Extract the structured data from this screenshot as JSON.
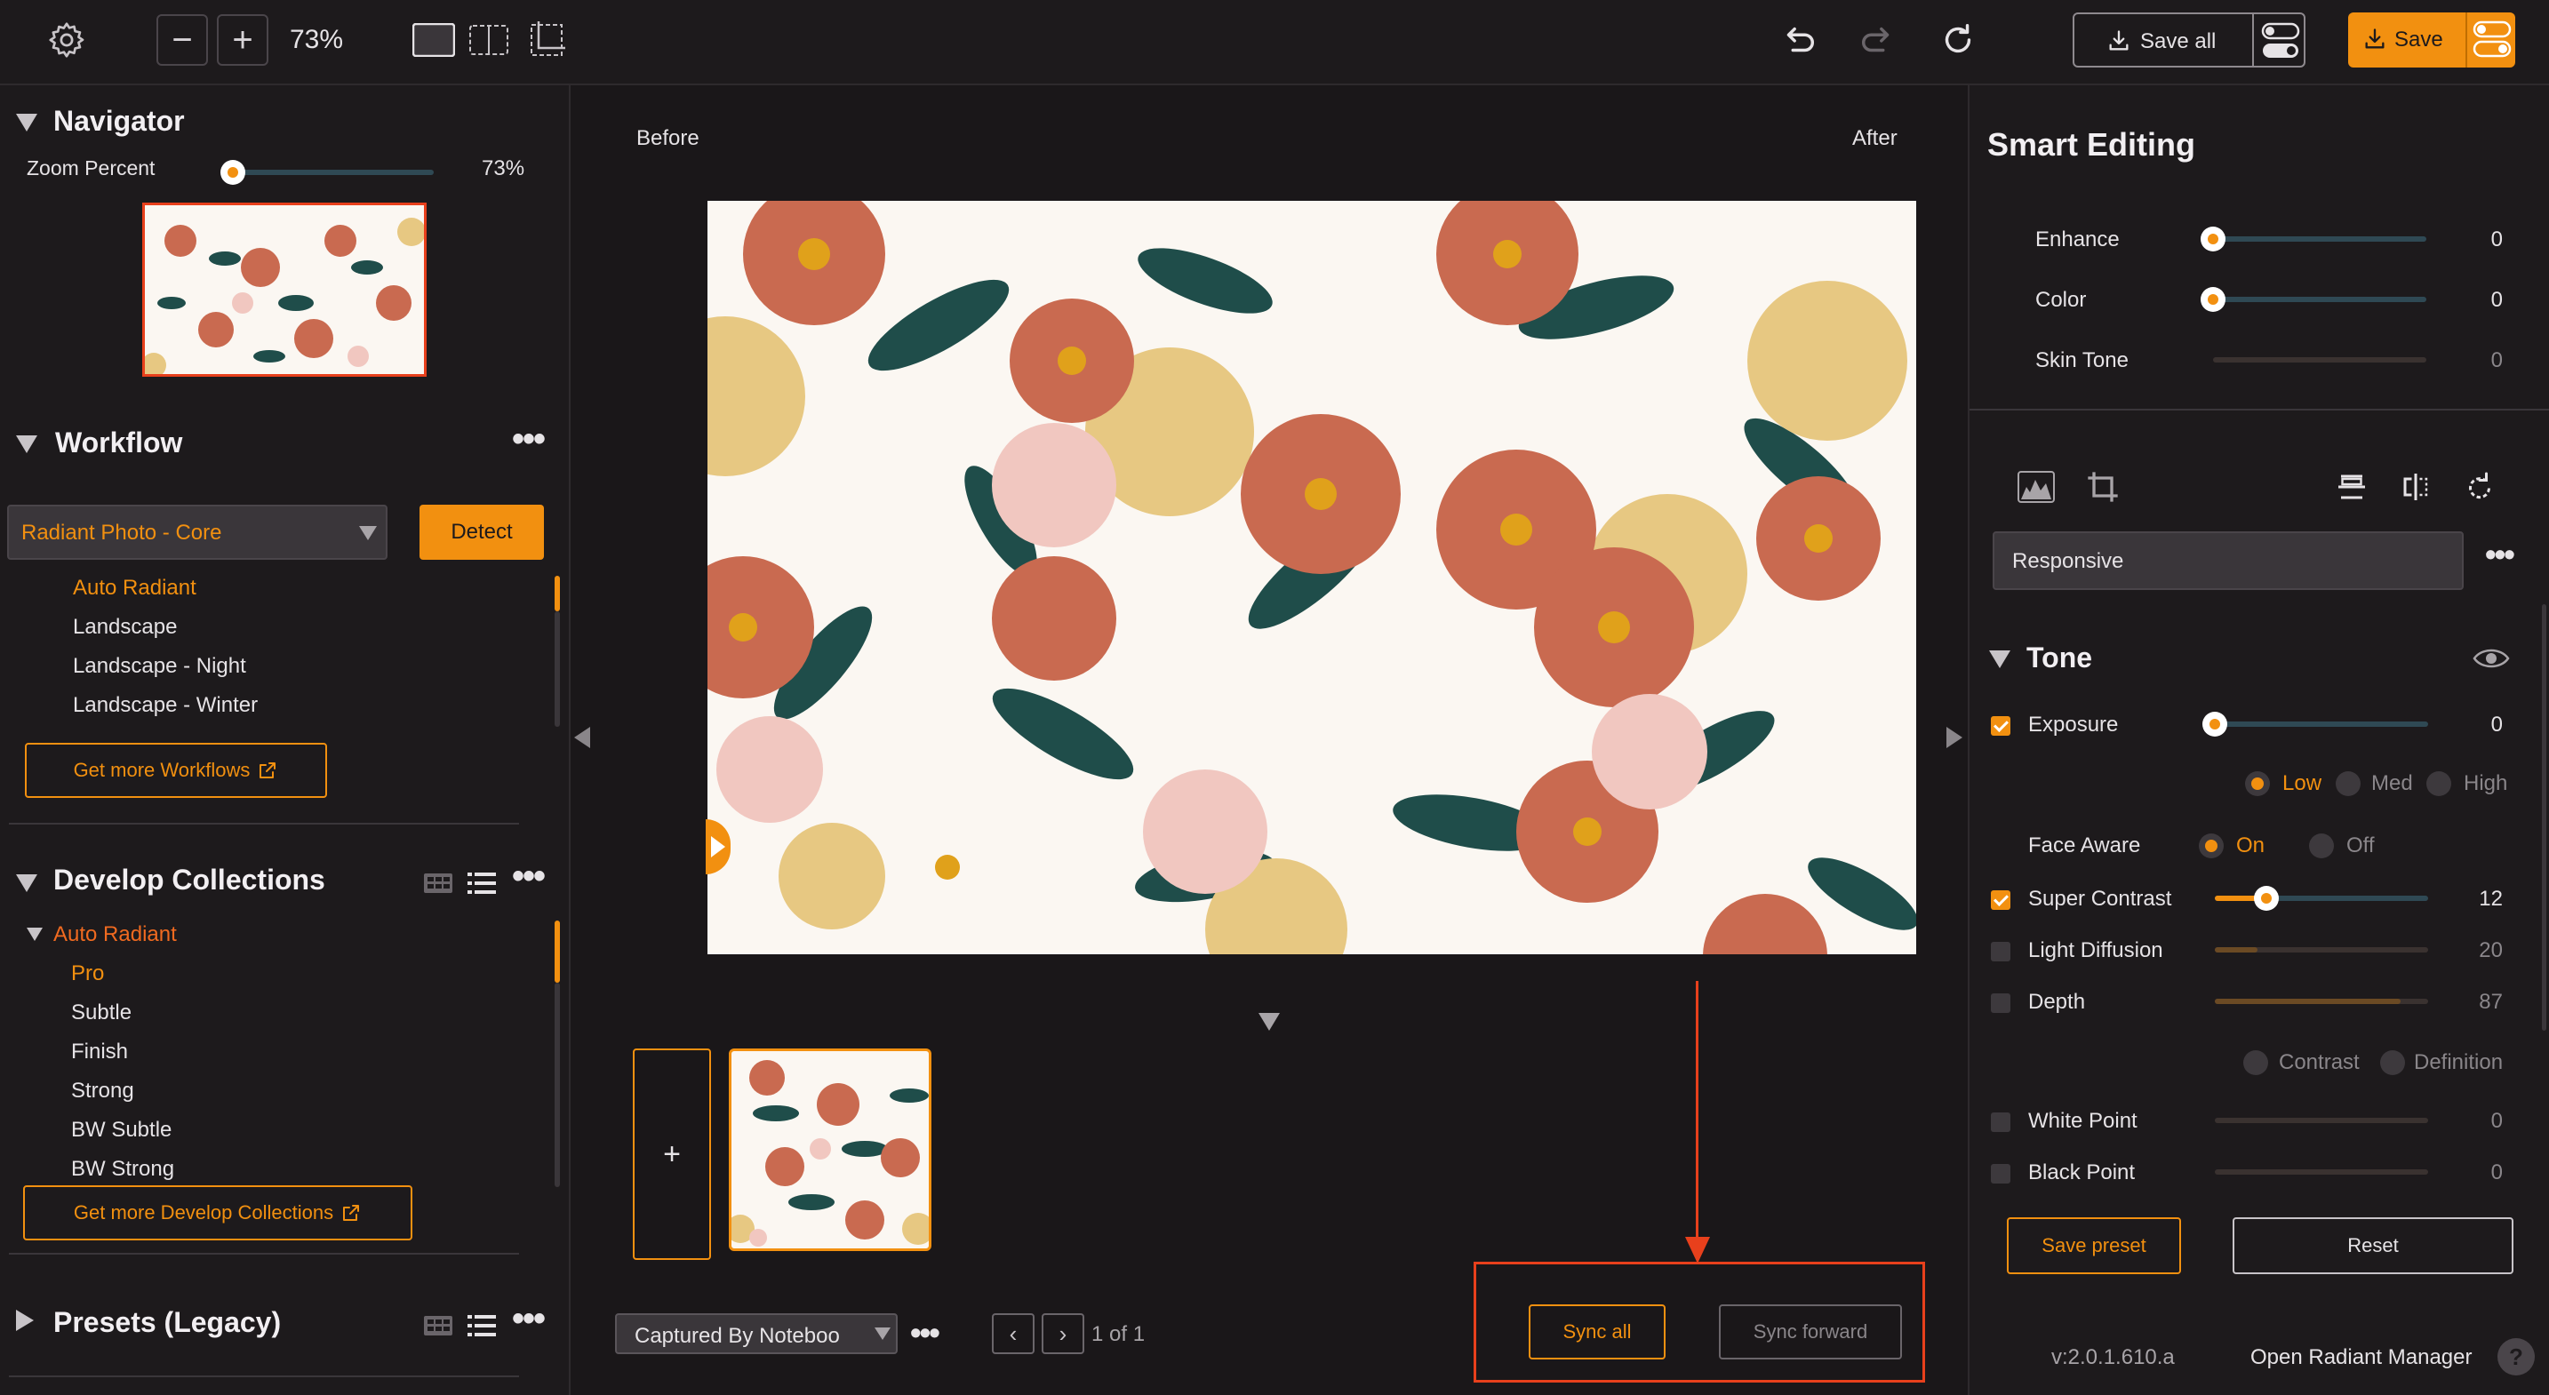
{
  "toolbar": {
    "zoom_out": "−",
    "zoom_in": "+",
    "zoom_level": "73%",
    "save_all_label": "Save all",
    "save_label": "Save"
  },
  "navigator": {
    "title": "Navigator",
    "zoom_label": "Zoom Percent",
    "zoom_value": "73%",
    "zoom_fraction": 0.0
  },
  "workflow": {
    "title": "Workflow",
    "selected": "Radiant Photo - Core",
    "detect_label": "Detect",
    "items": [
      "Auto Radiant",
      "Landscape",
      "Landscape - Night",
      "Landscape - Winter"
    ],
    "get_more": "Get more Workflows"
  },
  "develop": {
    "title": "Develop Collections",
    "group": "Auto Radiant",
    "items": [
      "Pro",
      "Subtle",
      "Finish",
      "Strong",
      "BW Subtle",
      "BW Strong"
    ],
    "get_more": "Get more Develop Collections"
  },
  "presets": {
    "title": "Presets (Legacy)"
  },
  "center": {
    "before_label": "Before",
    "after_label": "After",
    "add_label": "+",
    "folder_select": "Captured By Noteboo",
    "page_info": "1 of 1",
    "sync_all": "Sync all",
    "sync_forward": "Sync forward"
  },
  "smart": {
    "title": "Smart Editing",
    "sliders": [
      {
        "label": "Enhance",
        "value": "0"
      },
      {
        "label": "Color",
        "value": "0"
      },
      {
        "label": "Skin Tone",
        "value": "0"
      }
    ],
    "mode": "Responsive"
  },
  "tone": {
    "title": "Tone",
    "exposure": {
      "label": "Exposure",
      "value": "0"
    },
    "levels": [
      "Low",
      "Med",
      "High"
    ],
    "face_aware": {
      "label": "Face Aware",
      "on": "On",
      "off": "Off"
    },
    "super_contrast": {
      "label": "Super Contrast",
      "value": "12",
      "fraction": 0.24
    },
    "light_diffusion": {
      "label": "Light Diffusion",
      "value": "20",
      "fraction": 0.2
    },
    "depth": {
      "label": "Depth",
      "value": "87",
      "fraction": 0.87
    },
    "depth_modes": [
      "Contrast",
      "Definition"
    ],
    "white_point": {
      "label": "White Point",
      "value": "0"
    },
    "black_point": {
      "label": "Black Point",
      "value": "0"
    },
    "save_preset": "Save preset",
    "reset": "Reset"
  },
  "footer": {
    "version": "v:2.0.1.610.a",
    "open_manager": "Open Radiant Manager",
    "help": "?"
  },
  "colors": {
    "accent": "#f29010",
    "background": "#1a1719",
    "panel": "#1d1a1c",
    "annotation": "#e8401c"
  }
}
